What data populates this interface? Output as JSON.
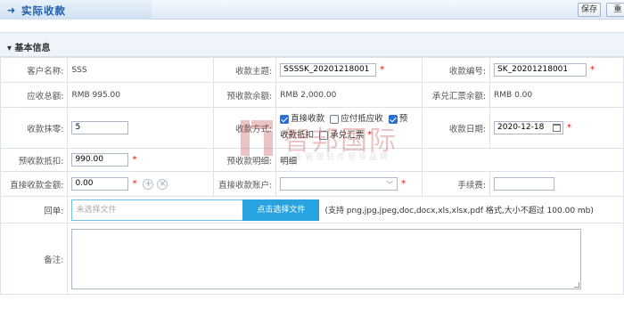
{
  "header": {
    "title": "实际收款",
    "buttons": {
      "save": "保存",
      "reset": "重"
    }
  },
  "section": {
    "title": "▾ 基本信息"
  },
  "fields": {
    "customer_name": {
      "label": "客户名称:",
      "value": "SSS"
    },
    "subject": {
      "label": "收款主题:",
      "value": "SSSSK_20201218001"
    },
    "number": {
      "label": "收款编号:",
      "value": "SK_20201218001"
    },
    "total_receivable": {
      "label": "应收总额:",
      "value": "RMB 995.00"
    },
    "prepaid_balance": {
      "label": "预收款余额:",
      "value": "RMB 2,000.00"
    },
    "acceptance_balance": {
      "label": "承兑汇票余额:",
      "value": "RMB 0.00"
    },
    "rounding": {
      "label": "收款抹零:",
      "value": "5"
    },
    "method": {
      "label": "收款方式:",
      "options": [
        {
          "label": "直接收款",
          "checked": true
        },
        {
          "label": "应付抵应收",
          "checked": false
        },
        {
          "label": "预",
          "checked": true
        },
        {
          "label": "收款抵扣",
          "checked": null
        },
        {
          "label": "承兑汇票",
          "checked": false
        }
      ]
    },
    "date": {
      "label": "收款日期:",
      "value": "2020-12-18"
    },
    "prepaid_deduction": {
      "label": "预收款抵扣:",
      "value": "990.00"
    },
    "prepaid_detail": {
      "label": "预收款明细:",
      "value": "明细"
    },
    "direct_amount": {
      "label": "直接收款金额:",
      "value": "0.00"
    },
    "direct_account": {
      "label": "直接收款账户:",
      "value": ""
    },
    "fee": {
      "label": "手续费:",
      "value": ""
    },
    "receipt": {
      "label": "回单:",
      "placeholder": "未选择文件",
      "button": "点击选择文件",
      "note": "(支持 png,jpg,jpeg,doc,docx,xls,xlsx,pdf 格式,大小不超过 100.00 mb)"
    },
    "remark": {
      "label": "备注:",
      "value": ""
    }
  },
  "required_mark": "*",
  "icons": {
    "title": "arrow-right-icon",
    "add": "plus-circle-icon",
    "remove": "close-circle-icon",
    "calendar": "calendar-icon",
    "dropdown": "chevron-down-icon"
  },
  "watermark": {
    "text": "智邦国际",
    "sub": "企业管理软件领导品牌"
  },
  "colors": {
    "accent": "#1f5fa8",
    "upload_button": "#29a3e0",
    "required": "#dd1111",
    "checkbox": "#2a6fd1"
  }
}
